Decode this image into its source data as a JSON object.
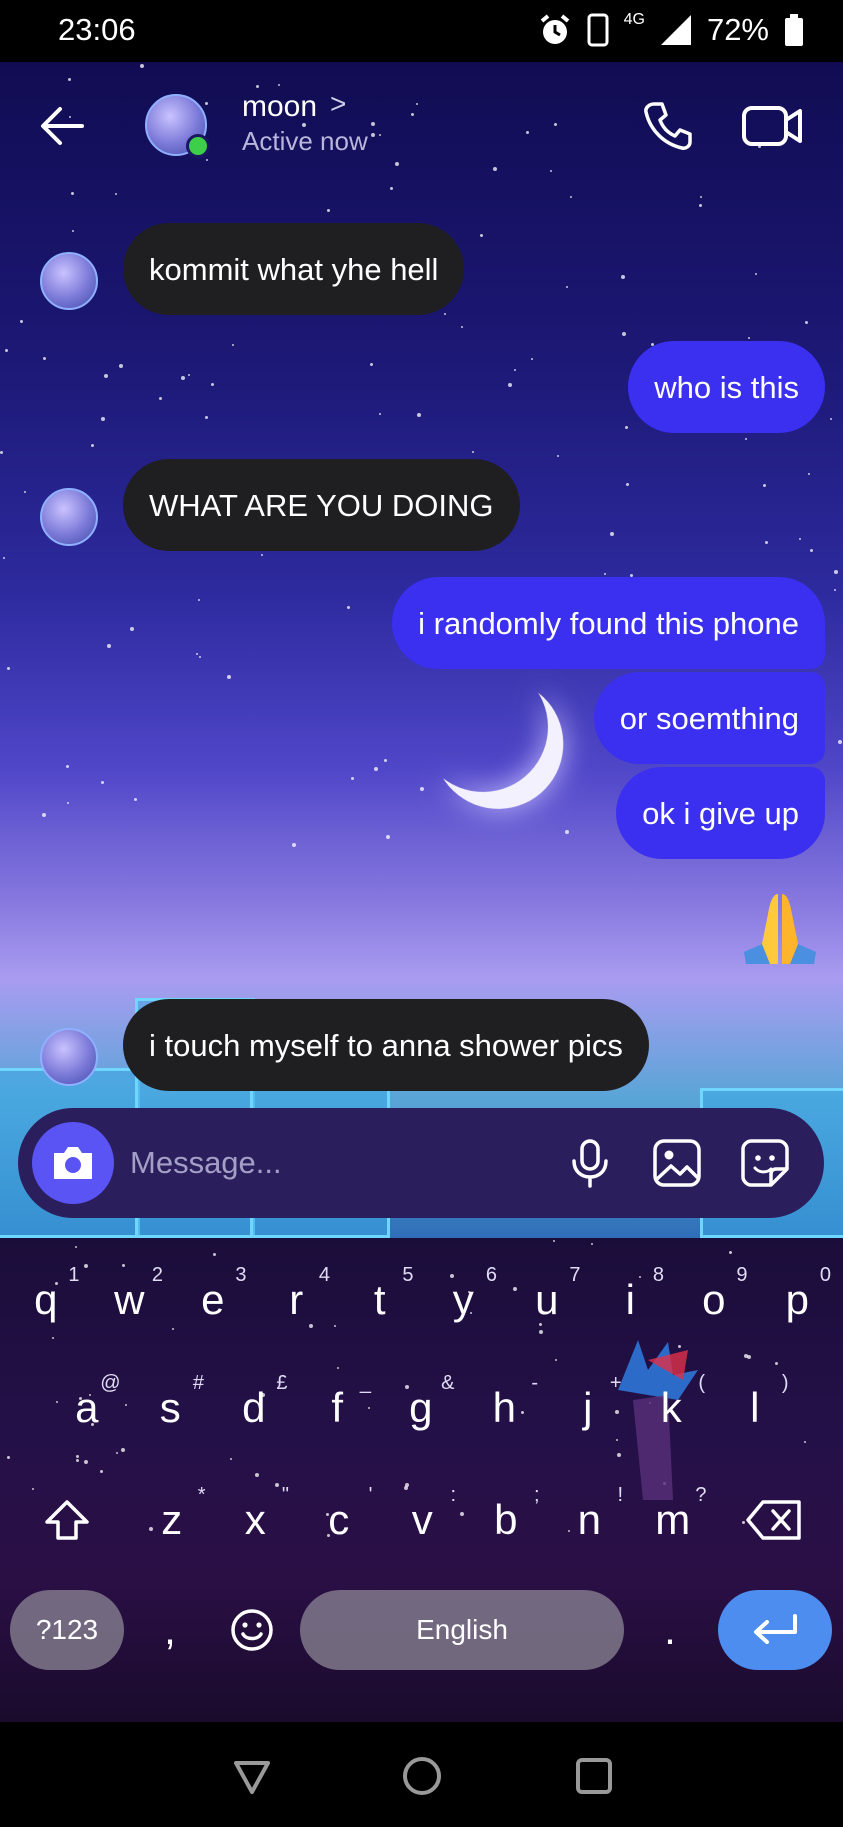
{
  "status_bar": {
    "time": "23:06",
    "network": "4G",
    "battery": "72%",
    "icons": [
      "alarm-icon",
      "vibrate-icon",
      "signal-icon",
      "battery-icon"
    ]
  },
  "header": {
    "contact_name": "moon",
    "status": "Active now",
    "chevron": ">"
  },
  "messages": [
    {
      "side": "in",
      "text": "kommit what yhe hell"
    },
    {
      "side": "out",
      "text": "who is this"
    },
    {
      "side": "in",
      "text": "WHAT ARE YOU DOING"
    },
    {
      "side": "out",
      "text": "i randomly found this phone"
    },
    {
      "side": "out",
      "text": "or soemthing"
    },
    {
      "side": "out",
      "text": "ok i give up"
    },
    {
      "side": "out",
      "emoji": "🙏",
      "icon": "folded-hands-emoji"
    },
    {
      "side": "in",
      "text": "i touch myself to anna shower pics"
    }
  ],
  "composer": {
    "placeholder": "Message..."
  },
  "keyboard": {
    "row1": [
      {
        "k": "q",
        "h": "1"
      },
      {
        "k": "w",
        "h": "2"
      },
      {
        "k": "e",
        "h": "3"
      },
      {
        "k": "r",
        "h": "4"
      },
      {
        "k": "t",
        "h": "5"
      },
      {
        "k": "y",
        "h": "6"
      },
      {
        "k": "u",
        "h": "7"
      },
      {
        "k": "i",
        "h": "8"
      },
      {
        "k": "o",
        "h": "9"
      },
      {
        "k": "p",
        "h": "0"
      }
    ],
    "row2": [
      {
        "k": "a",
        "h": "@"
      },
      {
        "k": "s",
        "h": "#"
      },
      {
        "k": "d",
        "h": "£"
      },
      {
        "k": "f",
        "h": "_"
      },
      {
        "k": "g",
        "h": "&"
      },
      {
        "k": "h",
        "h": "-"
      },
      {
        "k": "j",
        "h": "+"
      },
      {
        "k": "k",
        "h": "("
      },
      {
        "k": "l",
        "h": ")"
      }
    ],
    "row3": [
      {
        "k": "z",
        "h": "*"
      },
      {
        "k": "x",
        "h": "\""
      },
      {
        "k": "c",
        "h": "'"
      },
      {
        "k": "v",
        "h": ":"
      },
      {
        "k": "b",
        "h": ";"
      },
      {
        "k": "n",
        "h": "!"
      },
      {
        "k": "m",
        "h": "?"
      }
    ],
    "symbols_label": "?123",
    "comma": ",",
    "space_label": "English",
    "period": "."
  }
}
